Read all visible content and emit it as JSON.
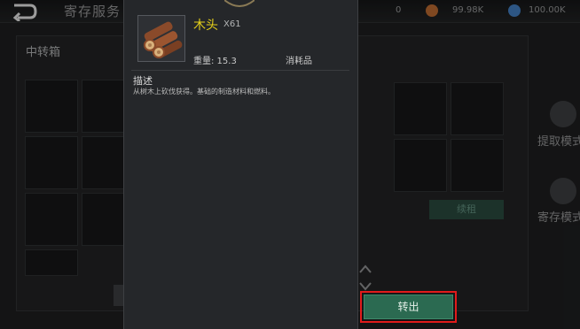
{
  "header": {
    "title": "寄存服务",
    "resources": [
      {
        "name": "resource-a",
        "value": "0"
      },
      {
        "name": "resource-b",
        "value": "99.98K",
        "color": "#b0642f"
      },
      {
        "name": "resource-c",
        "value": "100.00K",
        "color": "#3f78b8"
      }
    ]
  },
  "storage": {
    "title": "中转箱",
    "action_button": "续租"
  },
  "side_actions": {
    "withdraw_label": "提取模式",
    "deposit_label": "寄存模式"
  },
  "item": {
    "name": "木头",
    "count": "X61",
    "weight": "重量:  15.3",
    "type": "消耗品",
    "icon": "wood-logs-icon",
    "description_title": "描述",
    "description": "从树木上砍伐获得。基础的制造材料和燃料。"
  },
  "actions": {
    "transfer_label": "转出",
    "highlight_color": "#e11b1b",
    "button_color": "#2b6a51"
  }
}
